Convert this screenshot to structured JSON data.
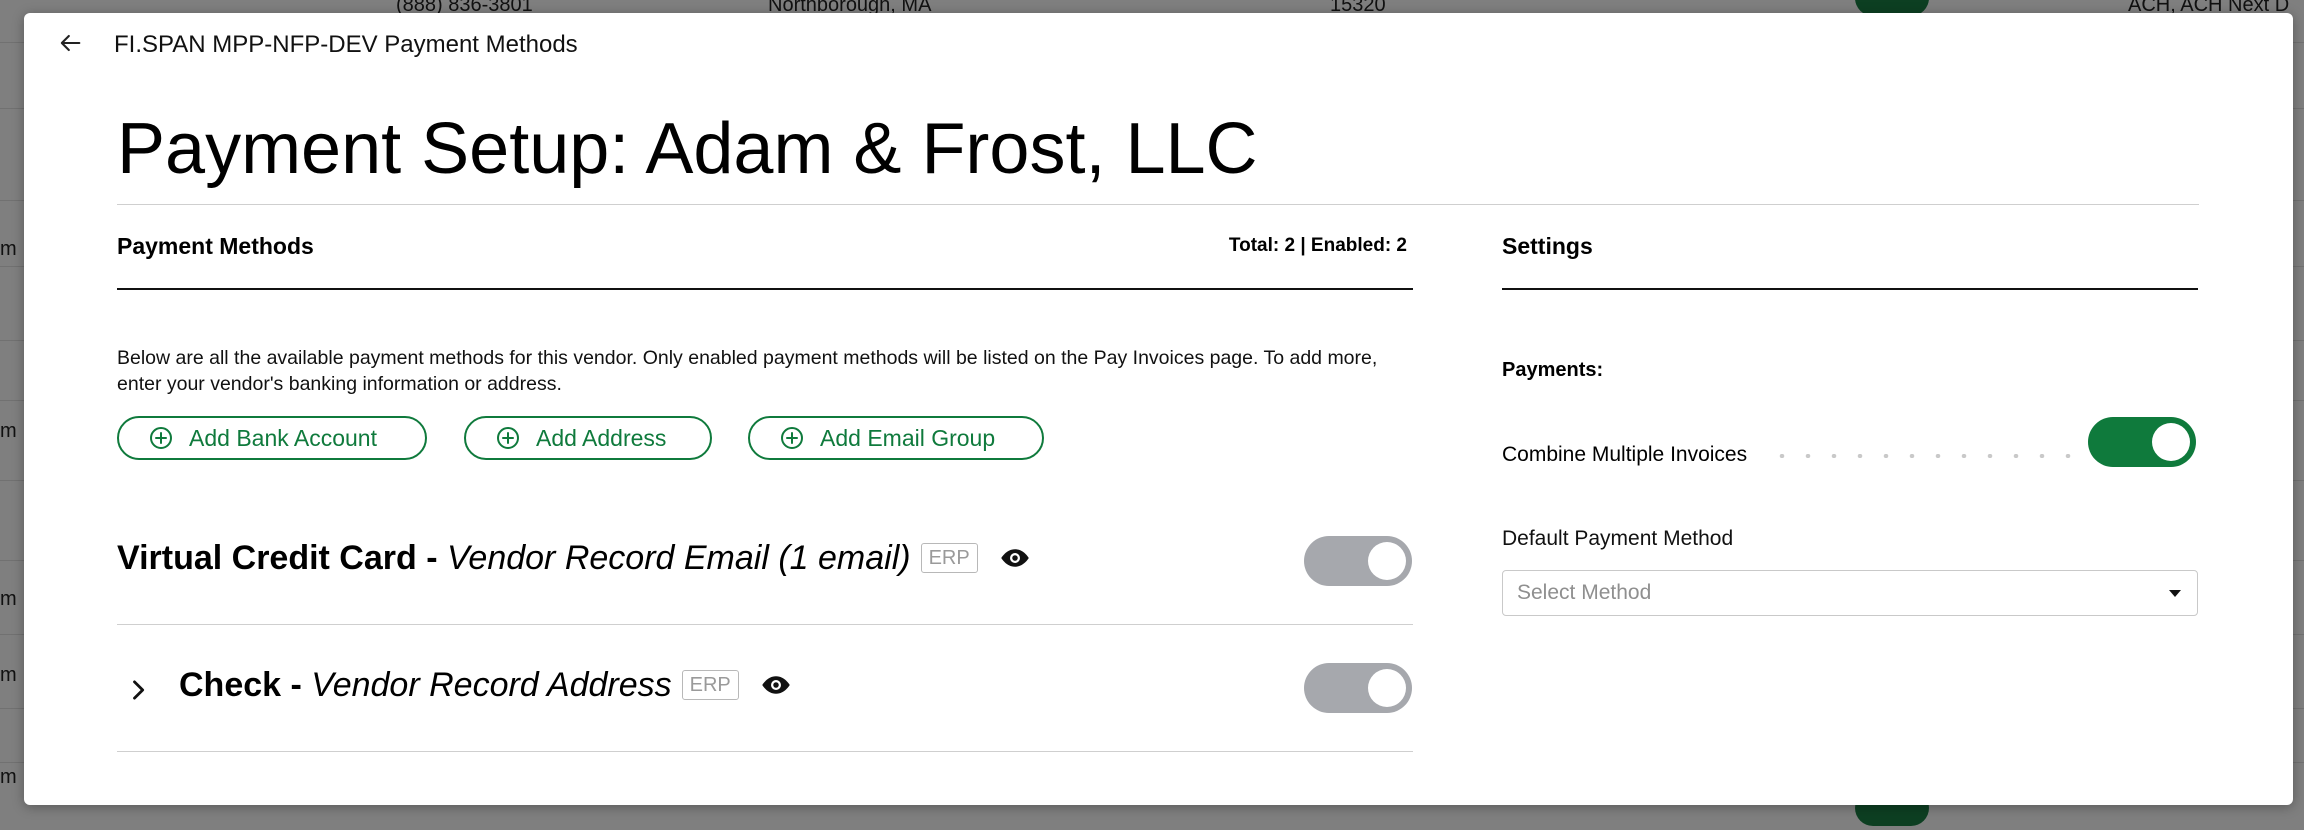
{
  "background": {
    "rows": [
      {
        "phone": "(888) 836-3801",
        "city": "Northborough, MA",
        "zip": "15320",
        "methods": "ACH, ACH Next D"
      }
    ],
    "left_fragment": "m"
  },
  "modal": {
    "title": "FI.SPAN MPP-NFP-DEV Payment Methods",
    "page_title": "Payment Setup: Adam & Frost, LLC",
    "payment_methods": {
      "heading": "Payment Methods",
      "totals": "Total: 2 | Enabled: 2",
      "description": "Below are all the available payment methods for this vendor. Only enabled payment methods will be listed on the Pay Invoices page. To add more, enter your vendor's banking information or address.",
      "buttons": {
        "add_bank_account": "Add Bank Account",
        "add_address": "Add Address",
        "add_email_group": "Add Email Group"
      },
      "items": [
        {
          "name": "Virtual Credit Card -",
          "detail": "Vendor Record Email (1 email)",
          "badge": "ERP",
          "enabled": false
        },
        {
          "name": "Check -",
          "detail": "Vendor Record Address",
          "badge": "ERP",
          "enabled": false
        }
      ]
    },
    "settings": {
      "heading": "Settings",
      "payments_label": "Payments:",
      "combine_label": "Combine Multiple Invoices",
      "combine_enabled": true,
      "default_method_label": "Default Payment Method",
      "default_method_placeholder": "Select Method"
    }
  },
  "colors": {
    "accent_green": "#0f7a3c",
    "toggle_off": "#a6a8ad"
  },
  "icons": [
    "back-arrow-icon",
    "plus-circle-icon",
    "eye-icon",
    "chevron-right-icon",
    "caret-down-icon"
  ]
}
